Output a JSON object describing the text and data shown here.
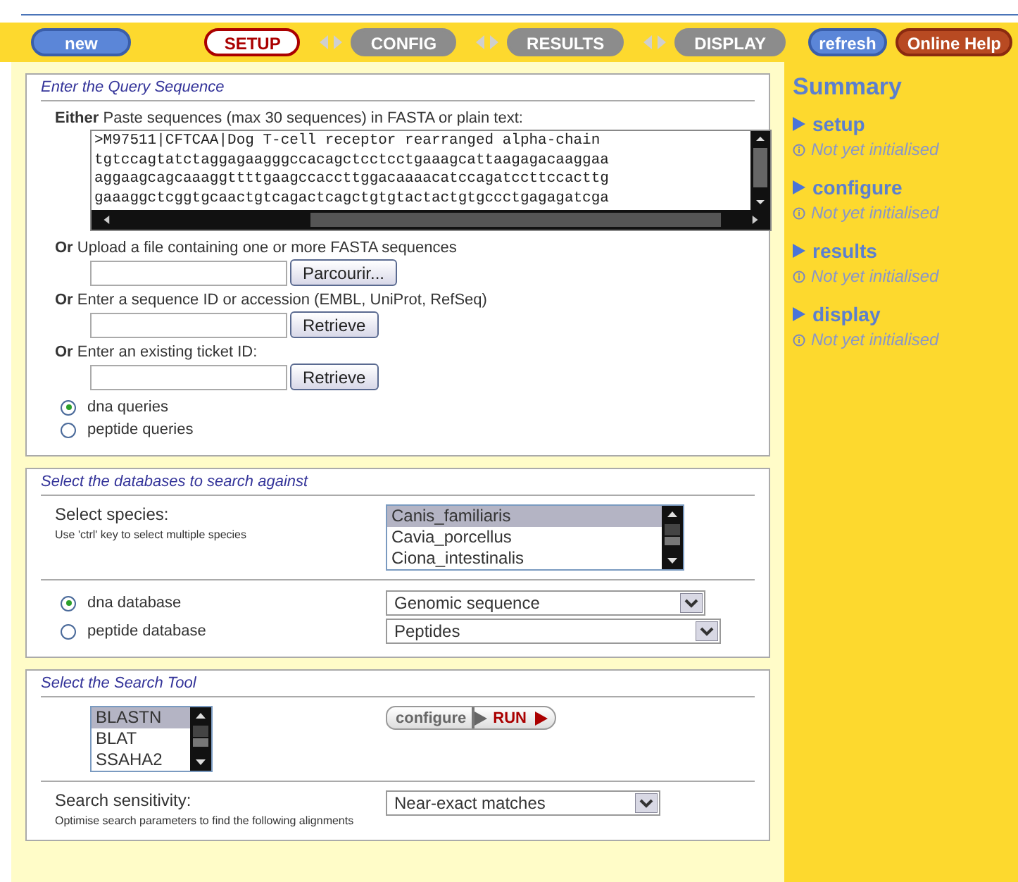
{
  "toolbar": {
    "new_button": "new",
    "steps": [
      {
        "label": "SETUP",
        "selected": true
      },
      {
        "label": "CONFIG",
        "selected": false
      },
      {
        "label": "RESULTS",
        "selected": false
      },
      {
        "label": "DISPLAY",
        "selected": false
      }
    ],
    "refresh_button": "refresh",
    "help_button": "Online Help"
  },
  "query_panel": {
    "title": "Enter the Query Sequence",
    "paste": {
      "lead": "Either",
      "text": "Paste sequences (max 30 sequences) in FASTA or plain text:",
      "lines": [
        ">M97511|CFTCAA|Dog T-cell receptor rearranged alpha-chain",
        "tgtccagtatctaggagaagggccacagctcctcctgaaagcattaagagacaaggaa",
        "aggaagcagcaaaggttttgaagccaccttggacaaaacatccagatccttccacttg",
        "gaaaggctcggtgcaactgtcagactcagctgtgtactactgtgccctgagagatcga"
      ]
    },
    "inputs": [
      {
        "lead": "Or",
        "text": "Upload a file containing one or more FASTA sequences",
        "button": "Parcourir..."
      },
      {
        "lead": "Or",
        "text": "Enter a sequence ID or accession (EMBL, UniProt, RefSeq)",
        "button": "Retrieve"
      },
      {
        "lead": "Or",
        "text": "Enter an existing ticket ID:",
        "button": "Retrieve"
      }
    ],
    "query_types": [
      {
        "label": "dna queries",
        "selected": true
      },
      {
        "label": "peptide queries",
        "selected": false
      }
    ]
  },
  "database_panel": {
    "title": "Select the databases to search against",
    "species_label": "Select species:",
    "species_hint": "Use 'ctrl' key to select multiple species",
    "species": [
      {
        "label": "Canis_familiaris",
        "selected": true
      },
      {
        "label": "Cavia_porcellus",
        "selected": false
      },
      {
        "label": "Ciona_intestinalis",
        "selected": false
      }
    ],
    "databases": [
      {
        "label": "dna database",
        "selected": true,
        "value": "Genomic sequence"
      },
      {
        "label": "peptide database",
        "selected": false,
        "value": "Peptides"
      }
    ]
  },
  "tool_panel": {
    "title": "Select the Search Tool",
    "tools": [
      {
        "label": "BLASTN",
        "selected": true
      },
      {
        "label": "BLAT",
        "selected": false
      },
      {
        "label": "SSAHA2",
        "selected": false
      }
    ],
    "configure_button": "configure",
    "run_button": "RUN",
    "sensitivity_label": "Search sensitivity:",
    "sensitivity_hint": "Optimise search parameters to find the following alignments",
    "sensitivity_value": "Near-exact matches"
  },
  "summary": {
    "title": "Summary",
    "sections": [
      {
        "label": "setup",
        "status": "Not yet initialised"
      },
      {
        "label": "configure",
        "status": "Not yet initialised"
      },
      {
        "label": "results",
        "status": "Not yet initialised"
      },
      {
        "label": "display",
        "status": "Not yet initialised"
      }
    ]
  }
}
